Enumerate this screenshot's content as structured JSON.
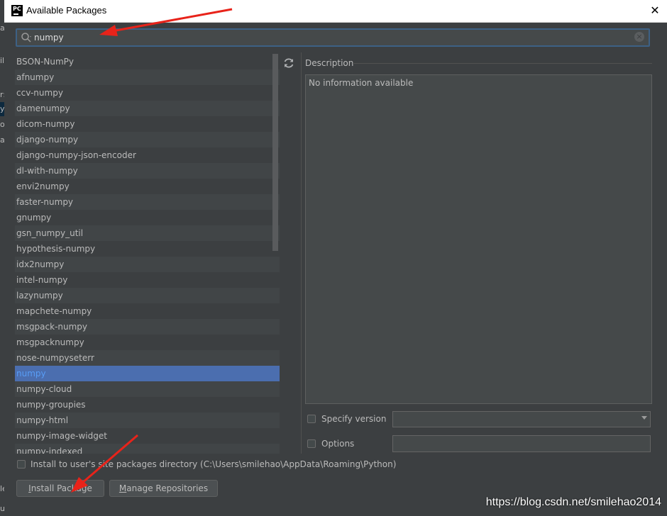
{
  "window": {
    "title": "Available Packages",
    "app_icon_text": "PC",
    "close_glyph": "✕"
  },
  "background_fragments": [
    "av",
    "il",
    "r:\\",
    "y",
    "or",
    "ar",
    "le",
    "ut end of file"
  ],
  "search": {
    "value": "numpy",
    "clear_glyph": "×"
  },
  "packages": [
    "BSON-NumPy",
    "afnumpy",
    "ccv-numpy",
    "damenumpy",
    "dicom-numpy",
    "django-numpy",
    "django-numpy-json-encoder",
    "dl-with-numpy",
    "envi2numpy",
    "faster-numpy",
    "gnumpy",
    "gsn_numpy_util",
    "hypothesis-numpy",
    "idx2numpy",
    "intel-numpy",
    "lazynumpy",
    "mapchete-numpy",
    "msgpack-numpy",
    "msgpacknumpy",
    "nose-numpyseterr",
    "numpy",
    "numpy-cloud",
    "numpy-groupies",
    "numpy-html",
    "numpy-image-widget",
    "numpy-indexed"
  ],
  "selected_package": "numpy",
  "description": {
    "label": "Description",
    "text": "No information available"
  },
  "options": {
    "specify_version_label": "Specify version",
    "options_label": "Options",
    "install_to_user_label": "Install to user's site packages directory (C:\\Users\\smilehao\\AppData\\Roaming\\Python)"
  },
  "buttons": {
    "install": "Install Package",
    "install_mnemonic": "I",
    "install_rest": "nstall Package",
    "manage": "Manage Repositories",
    "manage_mnemonic": "M",
    "manage_rest": "anage Repositories"
  },
  "watermark": "https://blog.csdn.net/smilehao2014",
  "colors": {
    "selection": "#4b6eaf",
    "annotation_arrow": "#e8231a"
  }
}
